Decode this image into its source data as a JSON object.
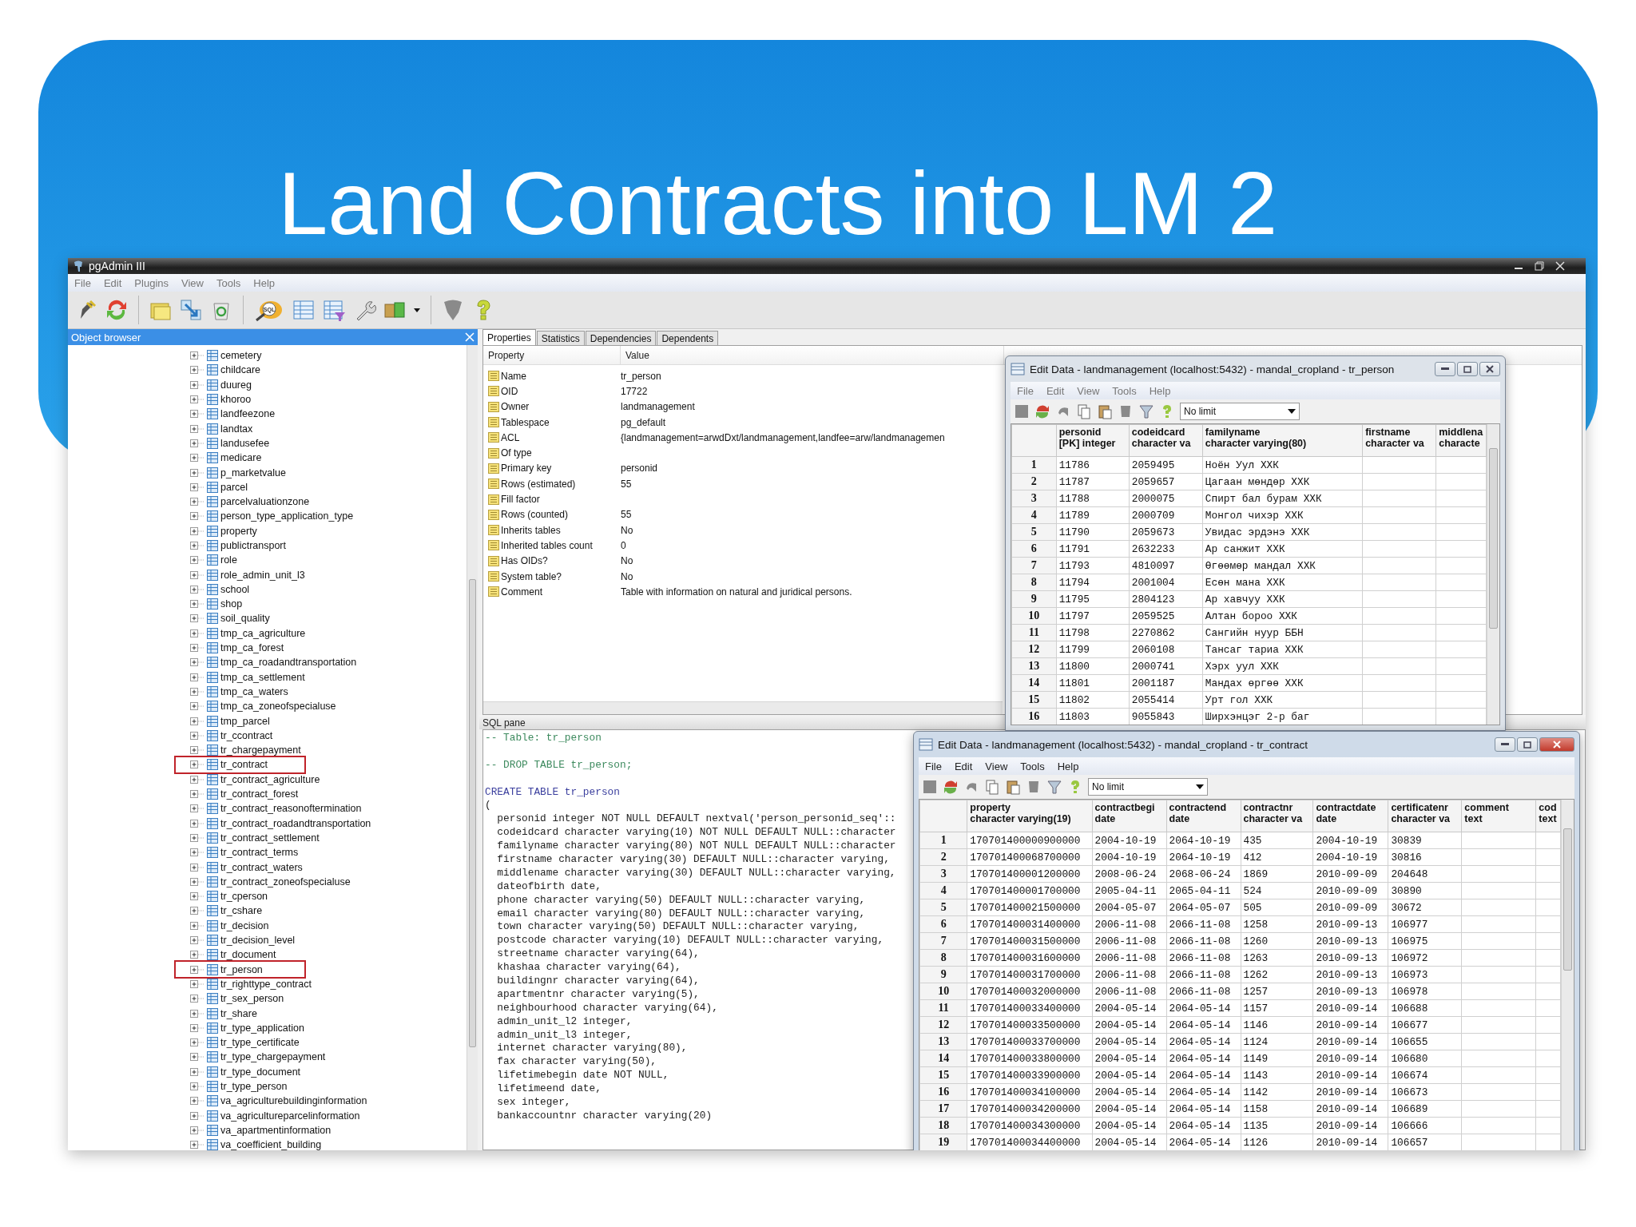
{
  "slide": {
    "title": "Land Contracts into LM 2"
  },
  "app": {
    "title": "pgAdmin III",
    "menu": [
      "File",
      "Edit",
      "Plugins",
      "View",
      "Tools",
      "Help"
    ],
    "sql_icon_label": "SQL"
  },
  "object_browser": {
    "title": "Object browser",
    "items": [
      {
        "label": "cemetery",
        "highlighted": false
      },
      {
        "label": "childcare",
        "highlighted": false
      },
      {
        "label": "duureg",
        "highlighted": false
      },
      {
        "label": "khoroo",
        "highlighted": false
      },
      {
        "label": "landfeezone",
        "highlighted": false
      },
      {
        "label": "landtax",
        "highlighted": false
      },
      {
        "label": "landusefee",
        "highlighted": false
      },
      {
        "label": "medicare",
        "highlighted": false
      },
      {
        "label": "p_marketvalue",
        "highlighted": false
      },
      {
        "label": "parcel",
        "highlighted": false
      },
      {
        "label": "parcelvaluationzone",
        "highlighted": false
      },
      {
        "label": "person_type_application_type",
        "highlighted": false
      },
      {
        "label": "property",
        "highlighted": false
      },
      {
        "label": "publictransport",
        "highlighted": false
      },
      {
        "label": "role",
        "highlighted": false
      },
      {
        "label": "role_admin_unit_l3",
        "highlighted": false
      },
      {
        "label": "school",
        "highlighted": false
      },
      {
        "label": "shop",
        "highlighted": false
      },
      {
        "label": "soil_quality",
        "highlighted": false
      },
      {
        "label": "tmp_ca_agriculture",
        "highlighted": false
      },
      {
        "label": "tmp_ca_forest",
        "highlighted": false
      },
      {
        "label": "tmp_ca_roadandtransportation",
        "highlighted": false
      },
      {
        "label": "tmp_ca_settlement",
        "highlighted": false
      },
      {
        "label": "tmp_ca_waters",
        "highlighted": false
      },
      {
        "label": "tmp_ca_zoneofspecialuse",
        "highlighted": false
      },
      {
        "label": "tmp_parcel",
        "highlighted": false
      },
      {
        "label": "tr_ccontract",
        "highlighted": false
      },
      {
        "label": "tr_chargepayment",
        "highlighted": false
      },
      {
        "label": "tr_contract",
        "highlighted": true
      },
      {
        "label": "tr_contract_agriculture",
        "highlighted": false
      },
      {
        "label": "tr_contract_forest",
        "highlighted": false
      },
      {
        "label": "tr_contract_reasonoftermination",
        "highlighted": false
      },
      {
        "label": "tr_contract_roadandtransportation",
        "highlighted": false
      },
      {
        "label": "tr_contract_settlement",
        "highlighted": false
      },
      {
        "label": "tr_contract_terms",
        "highlighted": false
      },
      {
        "label": "tr_contract_waters",
        "highlighted": false
      },
      {
        "label": "tr_contract_zoneofspecialuse",
        "highlighted": false
      },
      {
        "label": "tr_cperson",
        "highlighted": false
      },
      {
        "label": "tr_cshare",
        "highlighted": false
      },
      {
        "label": "tr_decision",
        "highlighted": false
      },
      {
        "label": "tr_decision_level",
        "highlighted": false
      },
      {
        "label": "tr_document",
        "highlighted": false
      },
      {
        "label": "tr_person",
        "highlighted": true
      },
      {
        "label": "tr_righttype_contract",
        "highlighted": false
      },
      {
        "label": "tr_sex_person",
        "highlighted": false
      },
      {
        "label": "tr_share",
        "highlighted": false
      },
      {
        "label": "tr_type_application",
        "highlighted": false
      },
      {
        "label": "tr_type_certificate",
        "highlighted": false
      },
      {
        "label": "tr_type_chargepayment",
        "highlighted": false
      },
      {
        "label": "tr_type_document",
        "highlighted": false
      },
      {
        "label": "tr_type_person",
        "highlighted": false
      },
      {
        "label": "va_agriculturebuildinginformation",
        "highlighted": false
      },
      {
        "label": "va_agricultureparcelinformation",
        "highlighted": false
      },
      {
        "label": "va_apartmentinformation",
        "highlighted": false
      },
      {
        "label": "va_coefficient_building",
        "highlighted": false
      }
    ]
  },
  "tabs": [
    {
      "label": "Properties",
      "selected": true
    },
    {
      "label": "Statistics",
      "selected": false
    },
    {
      "label": "Dependencies",
      "selected": false
    },
    {
      "label": "Dependents",
      "selected": false
    }
  ],
  "properties": {
    "columns": [
      "Property",
      "Value"
    ],
    "rows": [
      {
        "property": "Name",
        "value": "tr_person"
      },
      {
        "property": "OID",
        "value": "17722"
      },
      {
        "property": "Owner",
        "value": "landmanagement"
      },
      {
        "property": "Tablespace",
        "value": "pg_default"
      },
      {
        "property": "ACL",
        "value": "{landmanagement=arwdDxt/landmanagement,landfee=arw/landmanagemen"
      },
      {
        "property": "Of type"
      },
      {
        "property": "Primary key",
        "value": "personid"
      },
      {
        "property": "Rows (estimated)",
        "value": "55"
      },
      {
        "property": "Fill factor"
      },
      {
        "property": "Rows (counted)",
        "value": "55"
      },
      {
        "property": "Inherits tables",
        "value": "No"
      },
      {
        "property": "Inherited tables count",
        "value": "0"
      },
      {
        "property": "Has OIDs?",
        "value": "No"
      },
      {
        "property": "System table?",
        "value": "No"
      },
      {
        "property": "Comment",
        "value": "Table with information on natural and juridical persons."
      }
    ]
  },
  "sql_pane": {
    "title": "SQL pane",
    "lines": [
      {
        "kind": "comment",
        "text": "-- Table: tr_person"
      },
      {
        "kind": "blank"
      },
      {
        "kind": "comment",
        "text": "-- DROP TABLE tr_person;"
      },
      {
        "kind": "blank"
      },
      {
        "kind": "keyword",
        "text": "CREATE TABLE tr_person"
      },
      {
        "kind": "code",
        "text": "("
      },
      {
        "kind": "code",
        "text": "  personid integer NOT NULL DEFAULT nextval('person_personid_seq'::"
      },
      {
        "kind": "code",
        "text": "  codeidcard character varying(10) NOT NULL DEFAULT NULL::character"
      },
      {
        "kind": "code",
        "text": "  familyname character varying(80) NOT NULL DEFAULT NULL::character"
      },
      {
        "kind": "code",
        "text": "  firstname character varying(30) DEFAULT NULL::character varying,"
      },
      {
        "kind": "code",
        "text": "  middlename character varying(30) DEFAULT NULL::character varying,"
      },
      {
        "kind": "code",
        "text": "  dateofbirth date,"
      },
      {
        "kind": "code",
        "text": "  phone character varying(50) DEFAULT NULL::character varying,"
      },
      {
        "kind": "code",
        "text": "  email character varying(80) DEFAULT NULL::character varying,"
      },
      {
        "kind": "code",
        "text": "  town character varying(50) DEFAULT NULL::character varying,"
      },
      {
        "kind": "code",
        "text": "  postcode character varying(10) DEFAULT NULL::character varying,"
      },
      {
        "kind": "code",
        "text": "  streetname character varying(64),"
      },
      {
        "kind": "code",
        "text": "  khashaa character varying(64),"
      },
      {
        "kind": "code",
        "text": "  buildingnr character varying(64),"
      },
      {
        "kind": "code",
        "text": "  apartmentnr character varying(5),"
      },
      {
        "kind": "code",
        "text": "  neighbourhood character varying(64),"
      },
      {
        "kind": "code",
        "text": "  admin_unit_l2 integer,"
      },
      {
        "kind": "code",
        "text": "  admin_unit_l3 integer,"
      },
      {
        "kind": "code",
        "text": "  internet character varying(80),"
      },
      {
        "kind": "code",
        "text": "  fax character varying(50),"
      },
      {
        "kind": "code",
        "text": "  lifetimebegin date NOT NULL,"
      },
      {
        "kind": "code",
        "text": "  lifetimeend date,"
      },
      {
        "kind": "code",
        "text": "  sex integer,"
      },
      {
        "kind": "code",
        "text": "  bankaccountnr character varying(20)"
      }
    ]
  },
  "edit_windows": [
    {
      "title": "Edit Data - landmanagement (localhost:5432) - mandal_cropland - tr_person",
      "menu": [
        "File",
        "Edit",
        "View",
        "Tools",
        "Help"
      ],
      "limit": "No limit",
      "active": false,
      "columns": [
        {
          "name": "personid",
          "type": "[PK] integer"
        },
        {
          "name": "codeidcard",
          "type": "character va"
        },
        {
          "name": "familyname",
          "type": "character varying(80)"
        },
        {
          "name": "firstname",
          "type": "character va"
        },
        {
          "name": "middlena",
          "type": "characte"
        }
      ],
      "rows": [
        {
          "num": "1",
          "cells": [
            "11786",
            "2059495",
            "Ноён Уул ХХК"
          ]
        },
        {
          "num": "2",
          "cells": [
            "11787",
            "2059657",
            "Цагаан мөндөр ХХК"
          ]
        },
        {
          "num": "3",
          "cells": [
            "11788",
            "2000075",
            "Спирт бал бурам ХХК"
          ]
        },
        {
          "num": "4",
          "cells": [
            "11789",
            "2000709",
            "Монгол чихэр ХХК"
          ]
        },
        {
          "num": "5",
          "cells": [
            "11790",
            "2059673",
            "Увидас эрдэнэ ХХК"
          ]
        },
        {
          "num": "6",
          "cells": [
            "11791",
            "2632233",
            "Ар санжит ХХК"
          ]
        },
        {
          "num": "7",
          "cells": [
            "11793",
            "4810097",
            "Өгөөмөр мандал ХХК"
          ]
        },
        {
          "num": "8",
          "cells": [
            "11794",
            "2001004",
            "Есөн мана ХХК"
          ]
        },
        {
          "num": "9",
          "cells": [
            "11795",
            "2804123",
            "Ар хавчуу ХХК"
          ]
        },
        {
          "num": "10",
          "cells": [
            "11797",
            "2059525",
            "Алтан бороо ХХК"
          ]
        },
        {
          "num": "11",
          "cells": [
            "11798",
            "2270862",
            "Сангийн нуур ББН"
          ]
        },
        {
          "num": "12",
          "cells": [
            "11799",
            "2060108",
            "Тансаг тариа ХХК"
          ]
        },
        {
          "num": "13",
          "cells": [
            "11800",
            "2000741",
            "Хэрх уул ХХК"
          ]
        },
        {
          "num": "14",
          "cells": [
            "11801",
            "2001187",
            "Мандах өргөө ХХК"
          ]
        },
        {
          "num": "15",
          "cells": [
            "11802",
            "2055414",
            "Урт гол ХХК"
          ]
        },
        {
          "num": "16",
          "cells": [
            "11803",
            "9055843",
            "Ширхэнцэг 2-р баг"
          ]
        }
      ]
    },
    {
      "title": "Edit Data - landmanagement (localhost:5432) - mandal_cropland - tr_contract",
      "menu": [
        "File",
        "Edit",
        "View",
        "Tools",
        "Help"
      ],
      "limit": "No limit",
      "active": true,
      "columns": [
        {
          "name": "property",
          "type": "character varying(19)"
        },
        {
          "name": "contractbegi",
          "type": "date"
        },
        {
          "name": "contractend",
          "type": "date"
        },
        {
          "name": "contractnr",
          "type": "character va"
        },
        {
          "name": "contractdate",
          "type": "date"
        },
        {
          "name": "certificatenr",
          "type": "character va"
        },
        {
          "name": "comment",
          "type": "text"
        },
        {
          "name": "cod",
          "type": "text"
        }
      ],
      "rows": [
        {
          "num": "1",
          "cells": [
            "170701400000900000",
            "2004-10-19",
            "2064-10-19",
            "435",
            "2004-10-19",
            "30839"
          ]
        },
        {
          "num": "2",
          "cells": [
            "170701400068700000",
            "2004-10-19",
            "2064-10-19",
            "412",
            "2004-10-19",
            "30816"
          ]
        },
        {
          "num": "3",
          "cells": [
            "170701400001200000",
            "2008-06-24",
            "2068-06-24",
            "1869",
            "2010-09-09",
            "204648"
          ]
        },
        {
          "num": "4",
          "cells": [
            "170701400001700000",
            "2005-04-11",
            "2065-04-11",
            "524",
            "2010-09-09",
            "30890"
          ]
        },
        {
          "num": "5",
          "cells": [
            "170701400021500000",
            "2004-05-07",
            "2064-05-07",
            "505",
            "2010-09-09",
            "30672"
          ]
        },
        {
          "num": "6",
          "cells": [
            "170701400031400000",
            "2006-11-08",
            "2066-11-08",
            "1258",
            "2010-09-13",
            "106977"
          ]
        },
        {
          "num": "7",
          "cells": [
            "170701400031500000",
            "2006-11-08",
            "2066-11-08",
            "1260",
            "2010-09-13",
            "106975"
          ]
        },
        {
          "num": "8",
          "cells": [
            "170701400031600000",
            "2006-11-08",
            "2066-11-08",
            "1263",
            "2010-09-13",
            "106972"
          ]
        },
        {
          "num": "9",
          "cells": [
            "170701400031700000",
            "2006-11-08",
            "2066-11-08",
            "1262",
            "2010-09-13",
            "106973"
          ]
        },
        {
          "num": "10",
          "cells": [
            "170701400032000000",
            "2006-11-08",
            "2066-11-08",
            "1257",
            "2010-09-13",
            "106978"
          ]
        },
        {
          "num": "11",
          "cells": [
            "170701400033400000",
            "2004-05-14",
            "2064-05-14",
            "1157",
            "2010-09-14",
            "106688"
          ]
        },
        {
          "num": "12",
          "cells": [
            "170701400033500000",
            "2004-05-14",
            "2064-05-14",
            "1146",
            "2010-09-14",
            "106677"
          ]
        },
        {
          "num": "13",
          "cells": [
            "170701400033700000",
            "2004-05-14",
            "2064-05-14",
            "1124",
            "2010-09-14",
            "106655"
          ]
        },
        {
          "num": "14",
          "cells": [
            "170701400033800000",
            "2004-05-14",
            "2064-05-14",
            "1149",
            "2010-09-14",
            "106680"
          ]
        },
        {
          "num": "15",
          "cells": [
            "170701400033900000",
            "2004-05-14",
            "2064-05-14",
            "1143",
            "2010-09-14",
            "106674"
          ]
        },
        {
          "num": "16",
          "cells": [
            "170701400034100000",
            "2004-05-14",
            "2064-05-14",
            "1142",
            "2010-09-14",
            "106673"
          ]
        },
        {
          "num": "17",
          "cells": [
            "170701400034200000",
            "2004-05-14",
            "2064-05-14",
            "1158",
            "2010-09-14",
            "106689"
          ]
        },
        {
          "num": "18",
          "cells": [
            "170701400034300000",
            "2004-05-14",
            "2064-05-14",
            "1135",
            "2010-09-14",
            "106666"
          ]
        },
        {
          "num": "19",
          "cells": [
            "170701400034400000",
            "2004-05-14",
            "2064-05-14",
            "1126",
            "2010-09-14",
            "106657"
          ]
        }
      ]
    }
  ]
}
